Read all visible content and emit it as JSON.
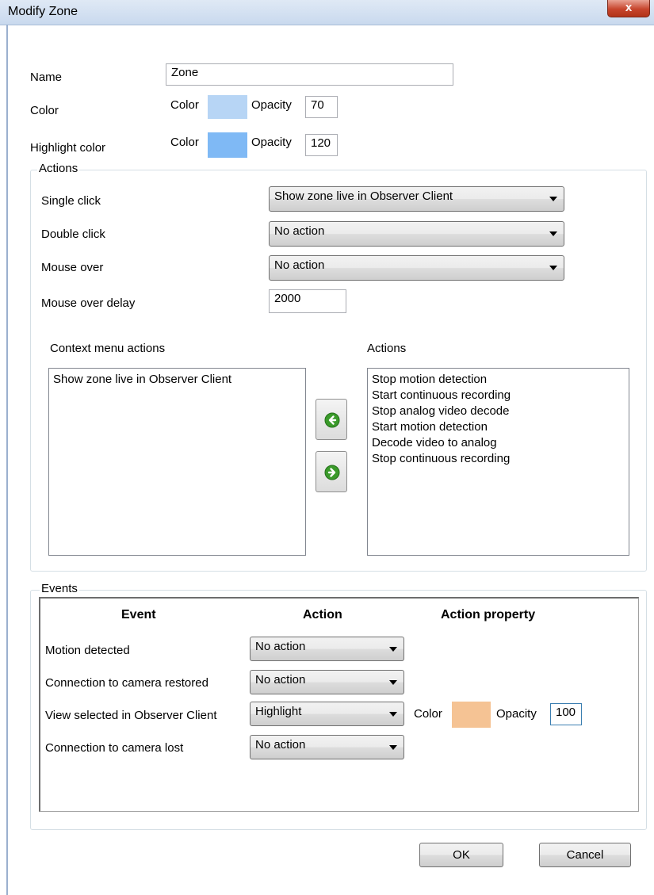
{
  "window": {
    "title": "Modify Zone",
    "close_label": "x"
  },
  "general": {
    "name_label": "Name",
    "name_value": "Zone",
    "color_label": "Color",
    "color_sub_label": "Color",
    "color_opacity_label": "Opacity",
    "color_opacity_value": "70",
    "color_swatch": "#b7d5f5",
    "highlight_label": "Highlight color",
    "highlight_color_sub_label": "Color",
    "highlight_opacity_label": "Opacity",
    "highlight_opacity_value": "120",
    "highlight_swatch": "#7fb9f5"
  },
  "actions": {
    "group_label": "Actions",
    "single_click_label": "Single click",
    "single_click_value": "Show zone live in Observer Client",
    "double_click_label": "Double click",
    "double_click_value": "No action",
    "mouse_over_label": "Mouse over",
    "mouse_over_value": "No action",
    "mouse_over_delay_label": "Mouse over delay",
    "mouse_over_delay_value": "2000",
    "context_menu_label": "Context menu actions",
    "context_menu_items": [
      "Show zone live in Observer Client"
    ],
    "available_label": "Actions",
    "available_items": [
      "Stop motion detection",
      "Start continuous recording",
      "Stop analog video decode",
      "Start motion detection",
      "Decode video to analog",
      "Stop continuous recording"
    ]
  },
  "events": {
    "group_label": "Events",
    "col_event": "Event",
    "col_action": "Action",
    "col_property": "Action property",
    "rows": [
      {
        "event": "Motion detected",
        "action": "No action"
      },
      {
        "event": "Connection to camera restored",
        "action": "No action"
      },
      {
        "event": "View selected in Observer Client",
        "action": "Highlight",
        "color_label": "Color",
        "opacity_label": "Opacity",
        "opacity_value": "100",
        "swatch": "#f5c394"
      },
      {
        "event": "Connection to camera lost",
        "action": "No action"
      }
    ]
  },
  "footer": {
    "ok_label": "OK",
    "cancel_label": "Cancel"
  }
}
